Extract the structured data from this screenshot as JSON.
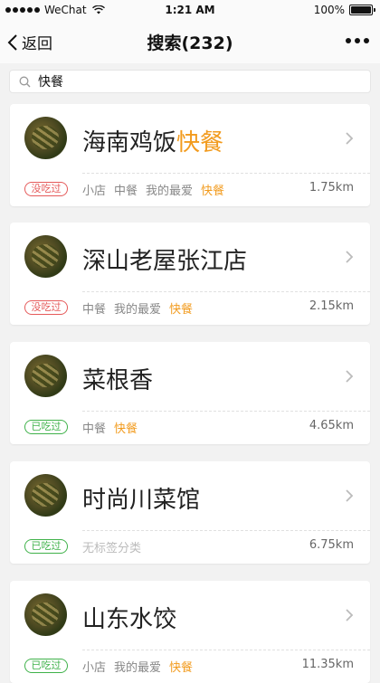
{
  "status_bar": {
    "carrier": "WeChat",
    "time": "1:21 AM",
    "battery": "100%",
    "battery_level": 1.0
  },
  "nav": {
    "back_label": "返回",
    "title": "搜索(232)"
  },
  "search": {
    "value": "快餐"
  },
  "results": [
    {
      "name": "海南鸡饭",
      "name_highlight": "快餐",
      "status": "没吃过",
      "status_color": "#e55a5a",
      "tags": [
        "小店",
        "中餐",
        "我的最爱"
      ],
      "tag_highlight": "快餐",
      "distance": "1.75km"
    },
    {
      "name": "深山老屋张江店",
      "name_highlight": "",
      "status": "没吃过",
      "status_color": "#e55a5a",
      "tags": [
        "中餐",
        "我的最爱"
      ],
      "tag_highlight": "快餐",
      "distance": "2.15km"
    },
    {
      "name": "菜根香",
      "name_highlight": "",
      "status": "已吃过",
      "status_color": "#3fb24a",
      "tags": [
        "中餐"
      ],
      "tag_highlight": "快餐",
      "distance": "4.65km"
    },
    {
      "name": "时尚川菜馆",
      "name_highlight": "",
      "status": "已吃过",
      "status_color": "#3fb24a",
      "tags": [
        "无标签分类"
      ],
      "tag_highlight": "",
      "distance": "6.75km"
    },
    {
      "name": "山东水饺",
      "name_highlight": "",
      "status": "已吃过",
      "status_color": "#3fb24a",
      "tags": [
        "小店",
        "我的最爱"
      ],
      "tag_highlight": "快餐",
      "distance": "11.35km"
    }
  ],
  "colors": {
    "highlight": "#f29b1e",
    "red": "#e55a5a",
    "green": "#3fb24a"
  }
}
